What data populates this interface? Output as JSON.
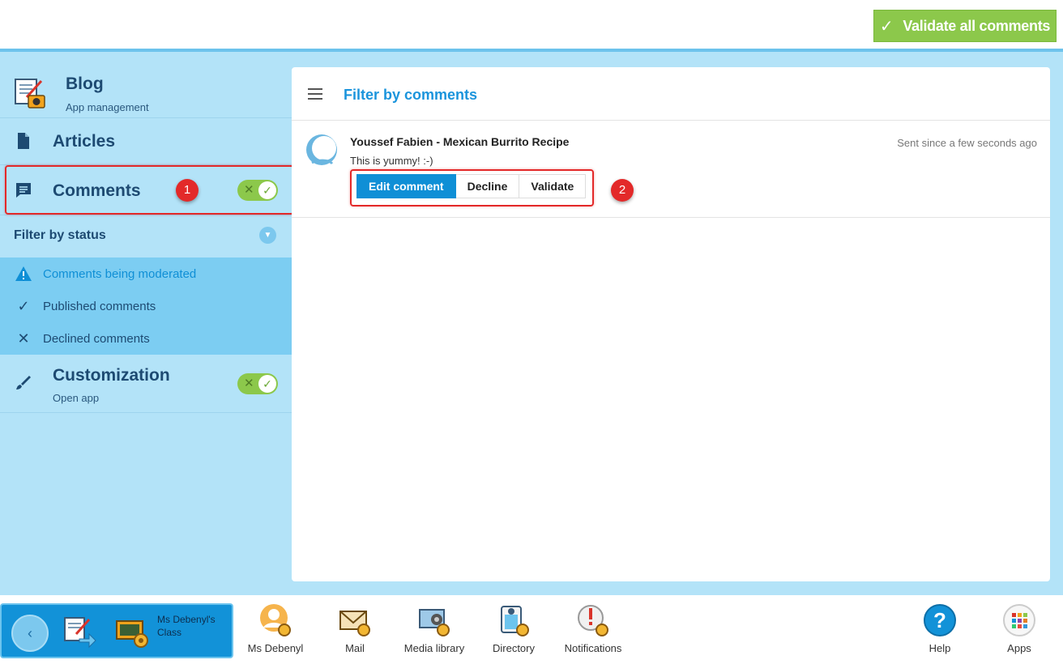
{
  "header": {
    "validate_all_label": "Validate all comments"
  },
  "sidebar": {
    "app_title": "Blog",
    "app_subtitle": "App management",
    "articles_label": "Articles",
    "comments_label": "Comments",
    "filter_label": "Filter by status",
    "filters": [
      {
        "label": "Comments being moderated",
        "icon": "warning-icon",
        "active": true
      },
      {
        "label": "Published comments",
        "icon": "checkmark-icon",
        "active": false
      },
      {
        "label": "Declined comments",
        "icon": "x-icon",
        "active": false
      }
    ],
    "customization_label": "Customization",
    "customization_sub": "Open app"
  },
  "annotations": {
    "badge1": "1",
    "badge2": "2"
  },
  "panel": {
    "title": "Filter by comments",
    "comment": {
      "author_title": "Youssef Fabien - Mexican Burrito Recipe",
      "text": "This is yummy! :-)",
      "time": "Sent since a few seconds ago",
      "buttons": {
        "edit": "Edit comment",
        "decline": "Decline",
        "validate": "Validate"
      }
    }
  },
  "dock": {
    "class_label": "Ms Debenyl's Class",
    "items": [
      {
        "label": "Ms Debenyl"
      },
      {
        "label": "Mail"
      },
      {
        "label": "Media library"
      },
      {
        "label": "Directory"
      },
      {
        "label": "Notifications"
      },
      {
        "label": "Help"
      },
      {
        "label": "Apps"
      }
    ]
  },
  "colors": {
    "accent": "#0f8fd6",
    "success": "#8cc84b",
    "sidebar_bg": "#b3e3f8",
    "highlight": "#e32929"
  }
}
